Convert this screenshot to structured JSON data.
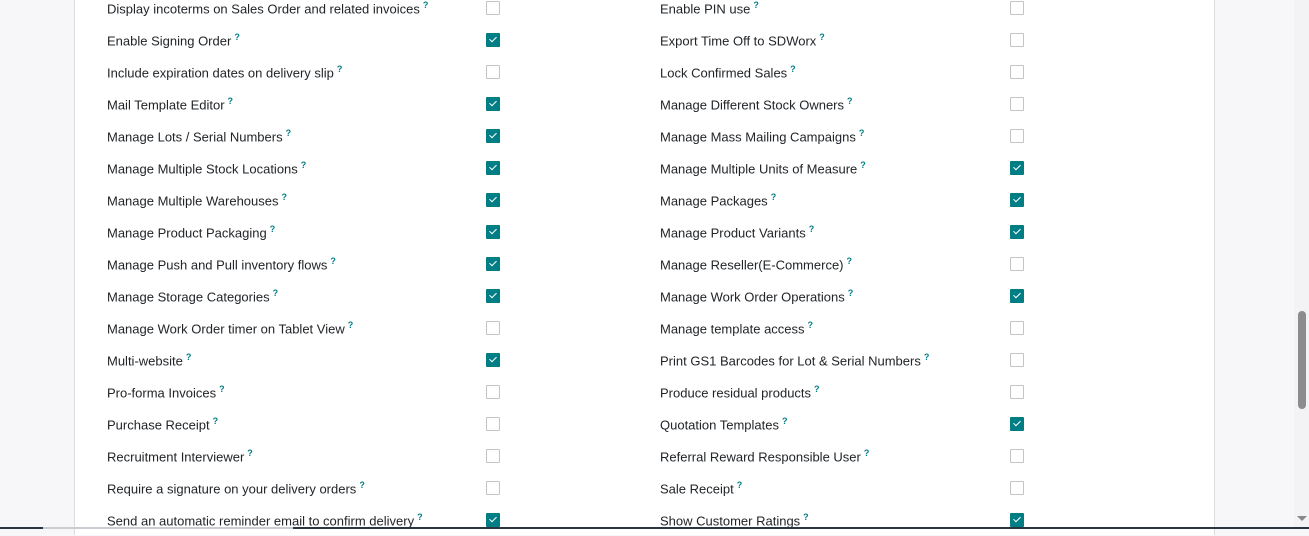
{
  "settings": {
    "help_marker": "?",
    "left_column": [
      {
        "label": "Display incoterms on Sales Order and related invoices",
        "checked": false
      },
      {
        "label": "Enable Signing Order",
        "checked": true
      },
      {
        "label": "Include expiration dates on delivery slip",
        "checked": false
      },
      {
        "label": "Mail Template Editor",
        "checked": true
      },
      {
        "label": "Manage Lots / Serial Numbers",
        "checked": true
      },
      {
        "label": "Manage Multiple Stock Locations",
        "checked": true
      },
      {
        "label": "Manage Multiple Warehouses",
        "checked": true
      },
      {
        "label": "Manage Product Packaging",
        "checked": true
      },
      {
        "label": "Manage Push and Pull inventory flows",
        "checked": true
      },
      {
        "label": "Manage Storage Categories",
        "checked": true
      },
      {
        "label": "Manage Work Order timer on Tablet View",
        "checked": false
      },
      {
        "label": "Multi-website",
        "checked": true
      },
      {
        "label": "Pro-forma Invoices",
        "checked": false
      },
      {
        "label": "Purchase Receipt",
        "checked": false
      },
      {
        "label": "Recruitment Interviewer",
        "checked": false
      },
      {
        "label": "Require a signature on your delivery orders",
        "checked": false
      },
      {
        "label": "Send an automatic reminder email to confirm delivery",
        "checked": true
      }
    ],
    "right_column": [
      {
        "label": "Enable PIN use",
        "checked": false
      },
      {
        "label": "Export Time Off to SDWorx",
        "checked": false
      },
      {
        "label": "Lock Confirmed Sales",
        "checked": false
      },
      {
        "label": "Manage Different Stock Owners",
        "checked": false
      },
      {
        "label": "Manage Mass Mailing Campaigns",
        "checked": false
      },
      {
        "label": "Manage Multiple Units of Measure",
        "checked": true
      },
      {
        "label": "Manage Packages",
        "checked": true
      },
      {
        "label": "Manage Product Variants",
        "checked": true
      },
      {
        "label": "Manage Reseller(E-Commerce)",
        "checked": false
      },
      {
        "label": "Manage Work Order Operations",
        "checked": true
      },
      {
        "label": "Manage template access",
        "checked": false
      },
      {
        "label": "Print GS1 Barcodes for Lot & Serial Numbers",
        "checked": false
      },
      {
        "label": "Produce residual products",
        "checked": false
      },
      {
        "label": "Quotation Templates",
        "checked": true
      },
      {
        "label": "Referral Reward Responsible User",
        "checked": false
      },
      {
        "label": "Sale Receipt",
        "checked": false
      },
      {
        "label": "Show Customer Ratings",
        "checked": true
      }
    ]
  },
  "colors": {
    "accent": "#017e84",
    "checkbox_border": "#c4c4c4",
    "text": "#212529"
  }
}
